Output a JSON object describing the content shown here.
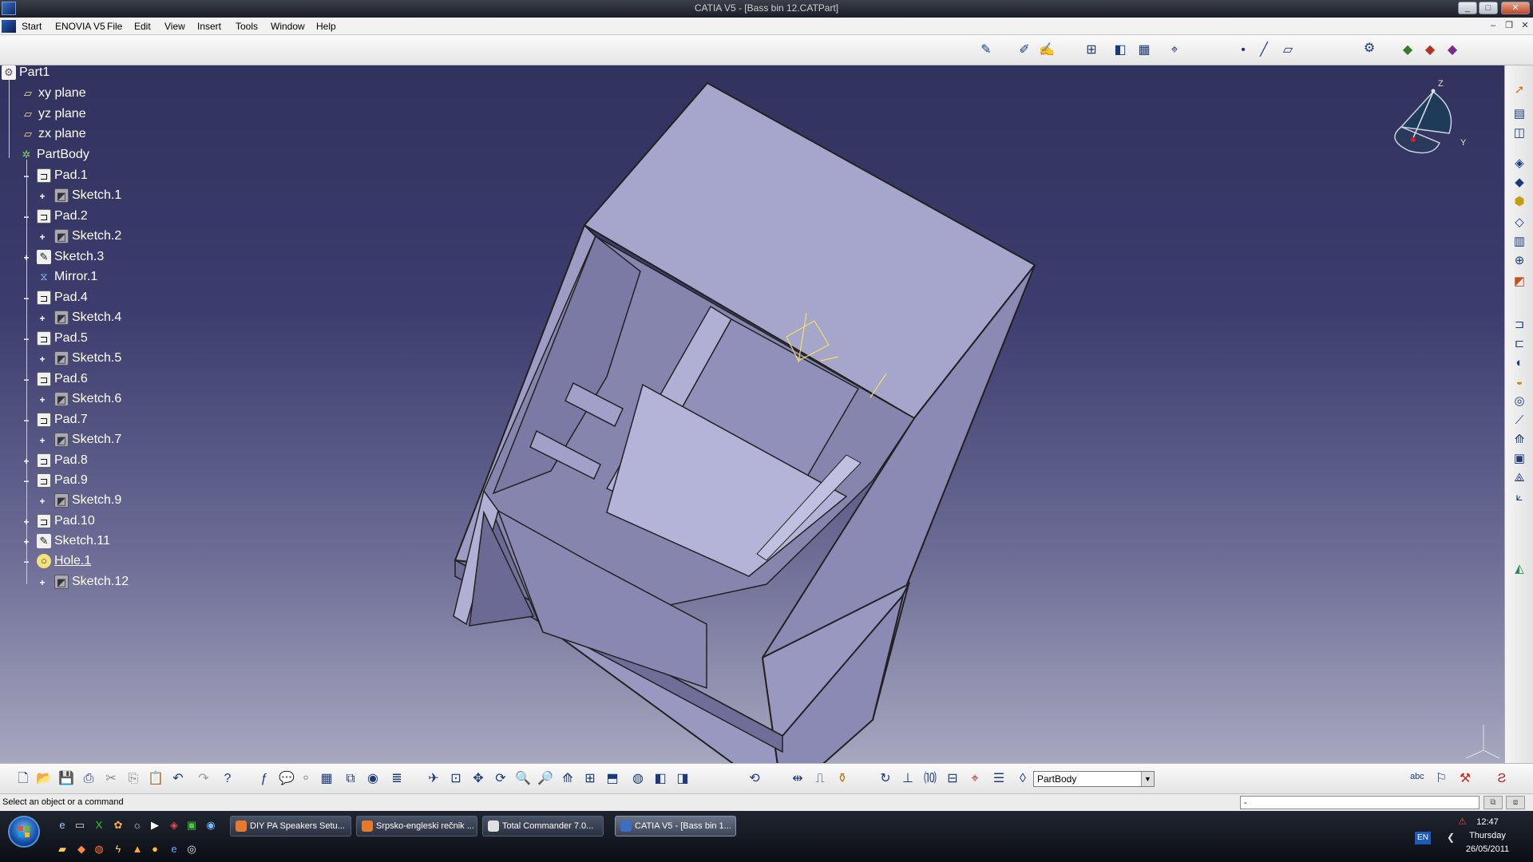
{
  "window": {
    "title": "CATIA V5 - [Bass bin 12.CATPart]",
    "controls": [
      "_",
      "□",
      "✕"
    ]
  },
  "menu": {
    "items": [
      "Start",
      "ENOVIA V5",
      "File",
      "Edit",
      "View",
      "Insert",
      "Tools",
      "Window",
      "Help"
    ]
  },
  "tree": {
    "nodes": [
      {
        "label": "Part1",
        "icon": "part-icon"
      },
      {
        "label": "xy plane",
        "icon": "plane-icon"
      },
      {
        "label": "yz plane",
        "icon": "plane-icon"
      },
      {
        "label": "zx plane",
        "icon": "plane-icon"
      },
      {
        "label": "PartBody",
        "icon": "body-icon"
      },
      {
        "label": "Pad.1",
        "icon": "pad-icon"
      },
      {
        "label": "Sketch.1",
        "icon": "sketch-icon"
      },
      {
        "label": "Pad.2",
        "icon": "pad-icon"
      },
      {
        "label": "Sketch.2",
        "icon": "sketch-icon"
      },
      {
        "label": "Sketch.3",
        "icon": "sketch-icon"
      },
      {
        "label": "Mirror.1",
        "icon": "mirror-icon"
      },
      {
        "label": "Pad.4",
        "icon": "pad-icon"
      },
      {
        "label": "Sketch.4",
        "icon": "sketch-icon"
      },
      {
        "label": "Pad.5",
        "icon": "pad-icon"
      },
      {
        "label": "Sketch.5",
        "icon": "sketch-icon"
      },
      {
        "label": "Pad.6",
        "icon": "pad-icon"
      },
      {
        "label": "Sketch.6",
        "icon": "sketch-icon"
      },
      {
        "label": "Pad.7",
        "icon": "pad-icon"
      },
      {
        "label": "Sketch.7",
        "icon": "sketch-icon"
      },
      {
        "label": "Pad.8",
        "icon": "pad-icon"
      },
      {
        "label": "Pad.9",
        "icon": "pad-icon"
      },
      {
        "label": "Sketch.9",
        "icon": "sketch-icon"
      },
      {
        "label": "Pad.10",
        "icon": "pad-icon"
      },
      {
        "label": "Sketch.11",
        "icon": "sketch-icon"
      },
      {
        "label": "Hole.1",
        "icon": "hole-icon"
      },
      {
        "label": "Sketch.12",
        "icon": "sketch-icon"
      }
    ]
  },
  "compass": {
    "axis_z": "Z",
    "axis_y": "Y"
  },
  "bottom_toolbar": {
    "body_select": "PartBody"
  },
  "status": {
    "message": "Select an object or a command",
    "command_input": "-"
  },
  "taskbar": {
    "tasks": [
      "DIY PA Speakers Setu...",
      "Srpsko-engleski rečnik ...",
      "Total Commander 7.0...",
      "CATIA V5 - [Bass bin 1..."
    ],
    "language": "EN",
    "time": "12:47",
    "day": "Thursday",
    "date": "26/05/2011"
  },
  "colors": {
    "viewport_top": "#32325e",
    "viewport_bottom": "#a7a7bf",
    "model_face_light": "#a6a6cc",
    "model_face_mid": "#8f8fb8",
    "model_face_dark": "#6e6e98",
    "tree_text": "#ffffff"
  }
}
